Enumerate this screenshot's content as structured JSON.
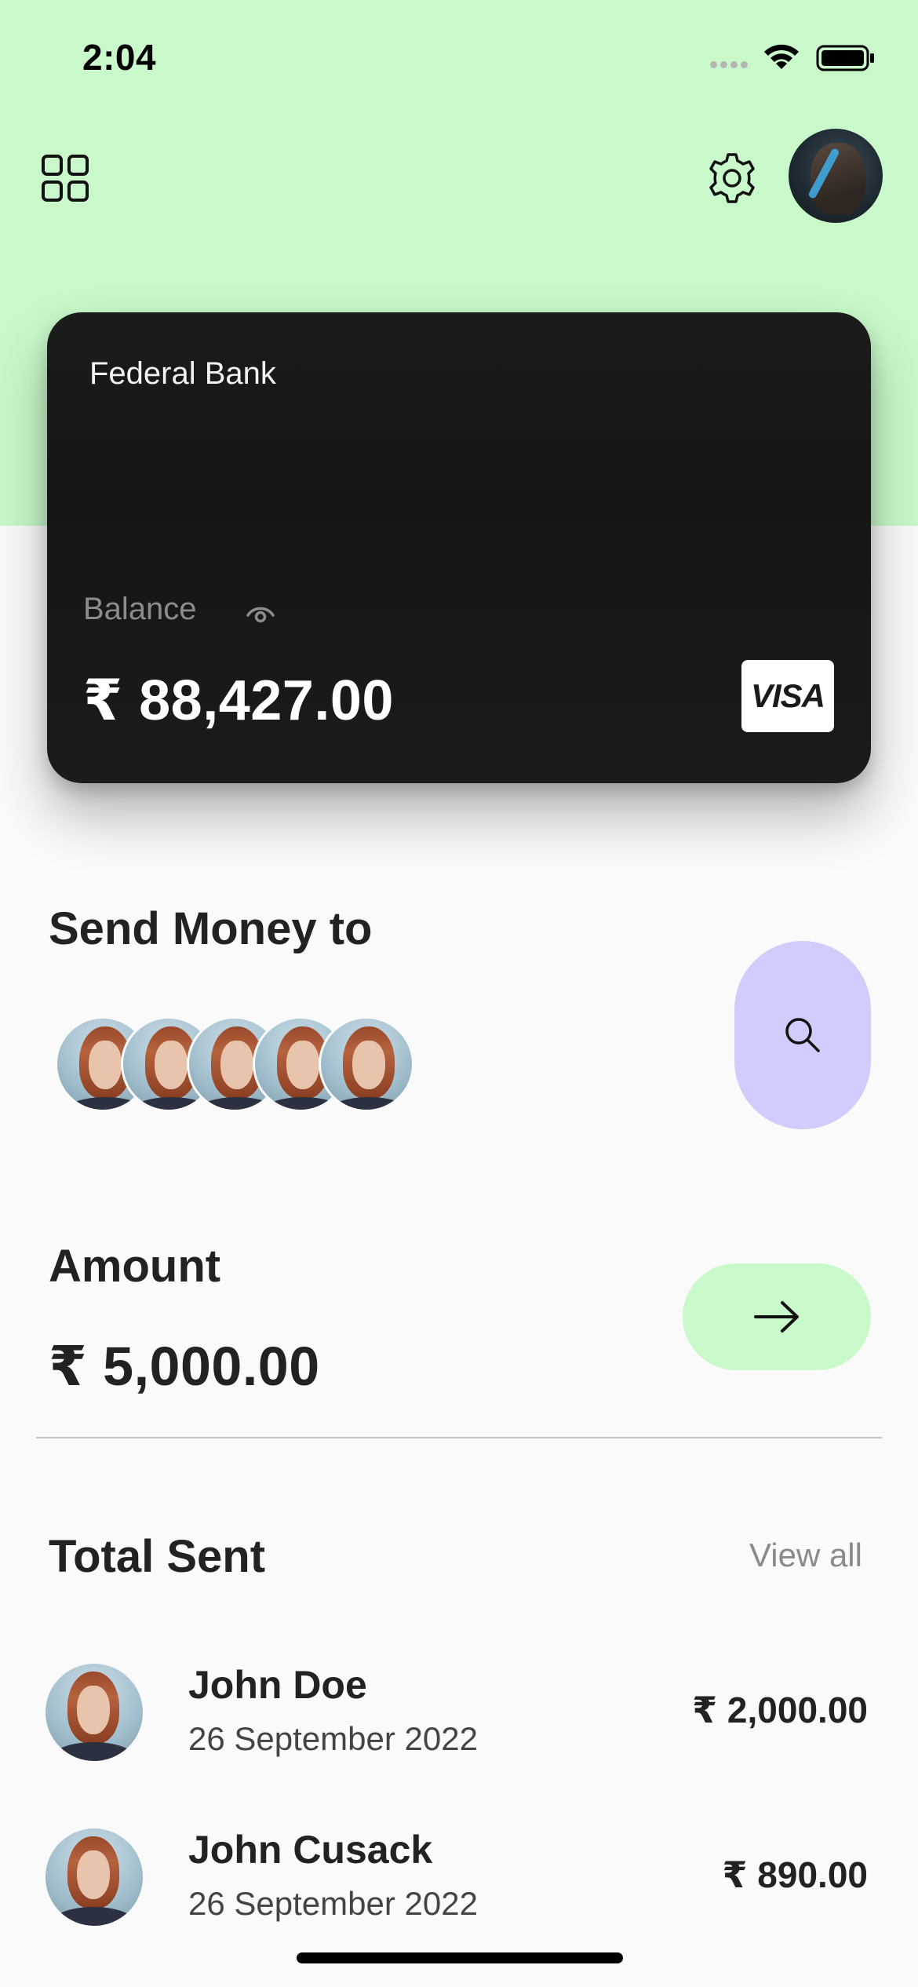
{
  "status_bar": {
    "time": "2:04"
  },
  "card": {
    "bank_name": "Federal Bank",
    "balance_label": "Balance",
    "balance": "₹ 88,427.00",
    "network": "VISA"
  },
  "send_money": {
    "title": "Send Money to",
    "contacts_count": 5
  },
  "amount": {
    "title": "Amount",
    "value": "₹ 5,000.00"
  },
  "total_sent": {
    "title": "Total Sent",
    "view_all": "View all",
    "transactions": [
      {
        "name": "John Doe",
        "date": "26 September 2022",
        "amount": "₹ 2,000.00"
      },
      {
        "name": "John Cusack",
        "date": "26 September 2022",
        "amount": "₹ 890.00"
      }
    ]
  },
  "colors": {
    "accent_green": "#c9f9cb",
    "accent_purple": "#d0ccfb",
    "card_dark": "#171717"
  },
  "icons": [
    "grid-icon",
    "gear-icon",
    "eye-icon",
    "search-icon",
    "arrow-right-icon",
    "wifi-icon",
    "battery-icon"
  ]
}
